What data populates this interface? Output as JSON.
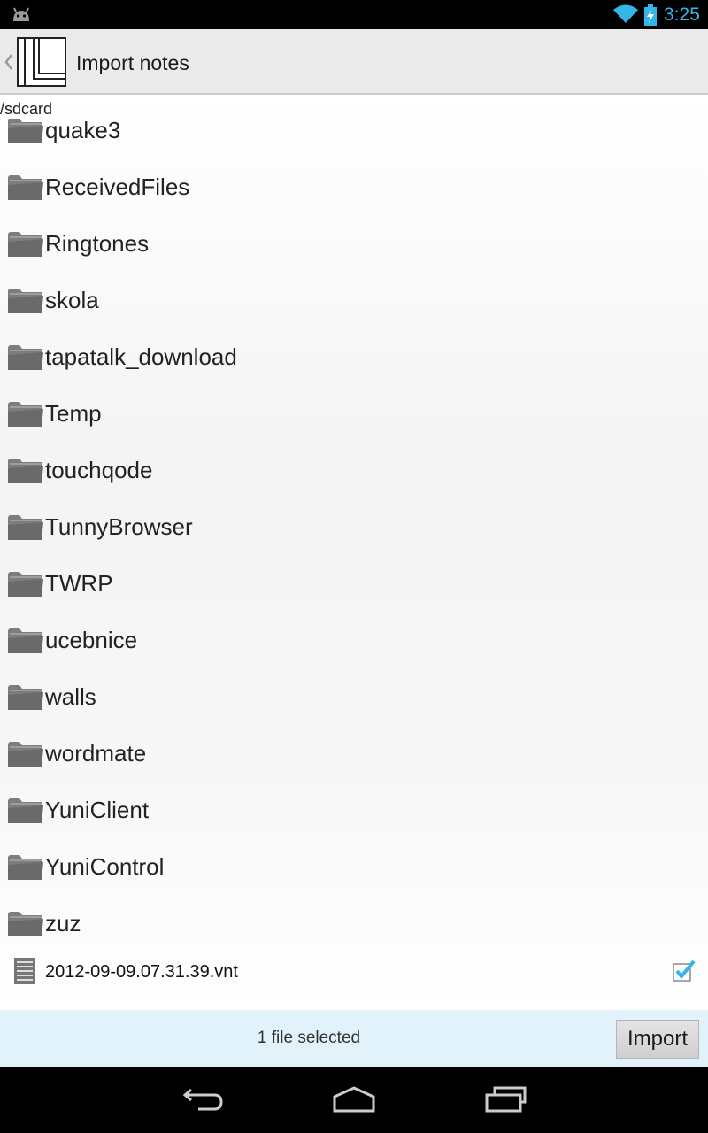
{
  "status_bar": {
    "time": "3:25",
    "icons": [
      "android-icon",
      "wifi-icon",
      "battery-charging-icon"
    ],
    "accent_color": "#33b5e5"
  },
  "action_bar": {
    "title": "Import notes",
    "icons": [
      "up-caret-icon",
      "app-icon"
    ]
  },
  "path": "/sdcard",
  "folders": [
    {
      "name": "quake3"
    },
    {
      "name": "ReceivedFiles"
    },
    {
      "name": "Ringtones"
    },
    {
      "name": "skola"
    },
    {
      "name": "tapatalk_download"
    },
    {
      "name": "Temp"
    },
    {
      "name": "touchqode"
    },
    {
      "name": "TunnyBrowser"
    },
    {
      "name": "TWRP"
    },
    {
      "name": "ucebnice"
    },
    {
      "name": "walls"
    },
    {
      "name": "wordmate"
    },
    {
      "name": "YuniClient"
    },
    {
      "name": "YuniControl"
    },
    {
      "name": "zuz"
    }
  ],
  "files": [
    {
      "name": "2012-09-09.07.31.39.vnt",
      "checked": true
    }
  ],
  "selection_bar": {
    "count_text": "1 file selected",
    "import_label": "Import",
    "background": "#e1f2fa"
  },
  "nav_bar": {
    "icons": [
      "back-icon",
      "home-icon",
      "recents-icon"
    ]
  }
}
